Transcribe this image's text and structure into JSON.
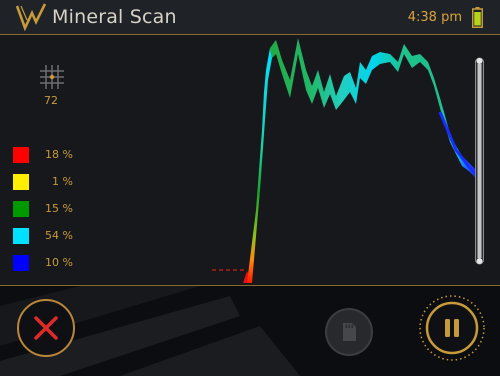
{
  "header": {
    "title": "Mineral Scan",
    "time": "4:38 pm",
    "logo_icon": "v-wave-logo-icon",
    "battery_icon": "battery-icon"
  },
  "scan": {
    "grid_icon": "grid-icon",
    "grid_value": "72"
  },
  "legend": [
    {
      "color": "#ff0000",
      "percent": "18 %"
    },
    {
      "color": "#ffee00",
      "percent": "1 %"
    },
    {
      "color": "#009900",
      "percent": "15 %"
    },
    {
      "color": "#00e0ff",
      "percent": "54 %"
    },
    {
      "color": "#0000ff",
      "percent": "10 %"
    }
  ],
  "footer": {
    "cancel_icon": "close-icon",
    "save_icon": "sd-card-icon",
    "pause_icon": "pause-icon"
  },
  "colors": {
    "accent": "#c79a3a",
    "header_bg": "#1f2227",
    "panel_bg": "#16181c"
  }
}
